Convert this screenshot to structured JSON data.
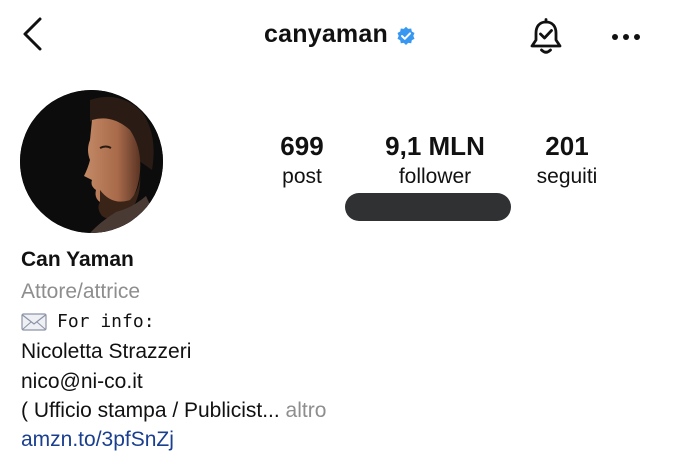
{
  "header": {
    "username": "canyaman",
    "verified": true,
    "icons": {
      "back": "chevron-left-icon",
      "verified": "verified-badge-icon",
      "notifications": "bell-check-icon",
      "more": "more-horizontal-icon"
    }
  },
  "stats": {
    "posts": {
      "value": "699",
      "label": "post"
    },
    "followers": {
      "value": "9,1 MLN",
      "label": "follower"
    },
    "following": {
      "value": "201",
      "label": "seguiti"
    }
  },
  "bio": {
    "name": "Can Yaman",
    "category": "Attore/attrice",
    "info_emoji": "envelope-icon",
    "info_label": "For info:",
    "contact_name": "Nicoletta Strazzeri",
    "email": "nico@ni-co.it",
    "description": "( Ufficio stampa / Publicist...",
    "more_label": "altro",
    "link": "amzn.to/3pfSnZj"
  },
  "colors": {
    "text": "#111111",
    "secondary": "#8e8e8e",
    "link": "#1a3f8f",
    "verified": "#3897f0",
    "redaction": "#2f3133"
  }
}
